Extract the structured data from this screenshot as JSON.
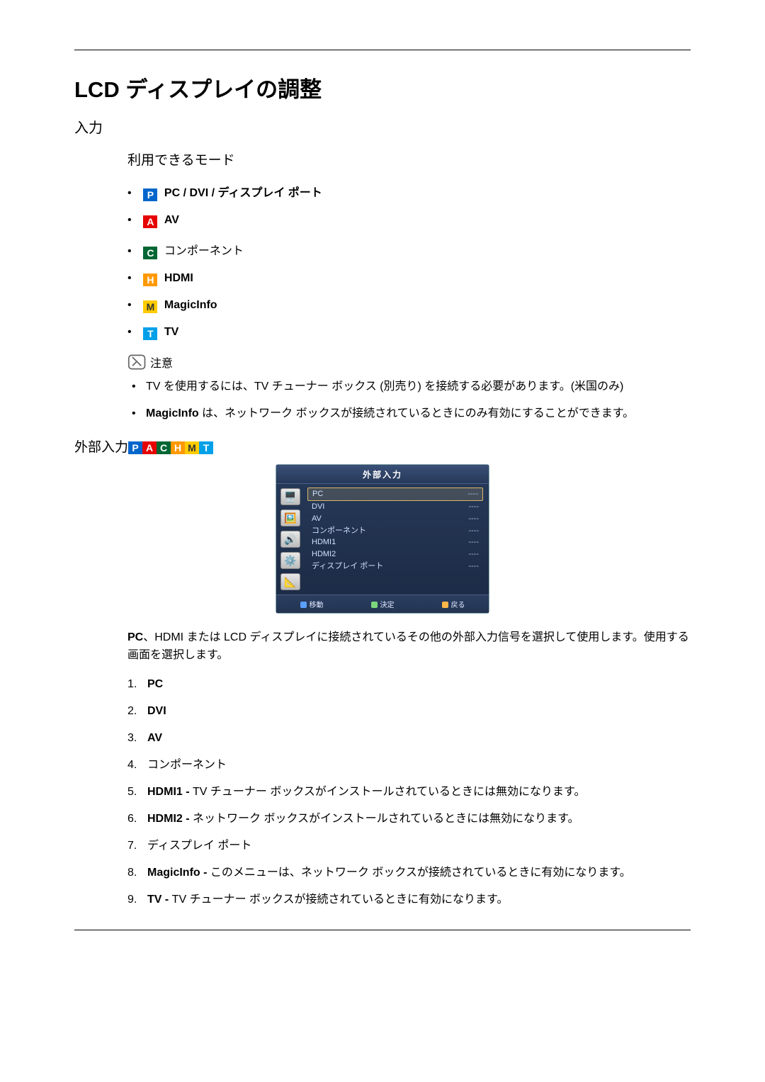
{
  "title": "LCD ディスプレイの調整",
  "section_input": "入力",
  "modes_heading": "利用できるモード",
  "mode_icons": {
    "P": "P",
    "A": "A",
    "C": "C",
    "H": "H",
    "M": "M",
    "T": "T"
  },
  "modes": [
    {
      "icon": "P",
      "label": "PC / DVI / ディスプレイ ポート",
      "bold": true
    },
    {
      "icon": "A",
      "label": "AV",
      "bold": true
    },
    {
      "icon": "C",
      "label": "コンポーネント",
      "bold": false
    },
    {
      "icon": "H",
      "label": "HDMI",
      "bold": true
    },
    {
      "icon": "M",
      "label": "MagicInfo",
      "bold": true
    },
    {
      "icon": "T",
      "label": "TV",
      "bold": true
    }
  ],
  "note_label": "注意",
  "notes": [
    "TV を使用するには、TV チューナー ボックス (別売り) を接続する必要があります。(米国のみ)",
    "MagicInfo は、ネットワーク ボックスが接続されているときにのみ有効にすることができます。"
  ],
  "notes_bold_lead": [
    "",
    "MagicInfo"
  ],
  "ext_heading": "外部入力",
  "osd": {
    "title": "外部入力",
    "rows": [
      {
        "label": "PC",
        "val": "----",
        "sel": true
      },
      {
        "label": "DVI",
        "val": "----",
        "sel": false
      },
      {
        "label": "AV",
        "val": "----",
        "sel": false
      },
      {
        "label": "コンポーネント",
        "val": "----",
        "sel": false
      },
      {
        "label": "HDMI1",
        "val": "----",
        "sel": false
      },
      {
        "label": "HDMI2",
        "val": "----",
        "sel": false
      },
      {
        "label": "ディスプレイ ポート",
        "val": "----",
        "sel": false
      }
    ],
    "foot": {
      "move": "移動",
      "enter": "決定",
      "return": "戻る"
    }
  },
  "ext_desc_lead_bold": "PC",
  "ext_desc_rest": "、HDMI または LCD ディスプレイに接続されているその他の外部入力信号を選択して使用します。使用する画面を選択します。",
  "inputs": [
    {
      "bold": "PC",
      "rest": ""
    },
    {
      "bold": "DVI",
      "rest": ""
    },
    {
      "bold": "AV",
      "rest": ""
    },
    {
      "bold": "",
      "rest": "コンポーネント"
    },
    {
      "bold": "HDMI1 - ",
      "rest": "TV チューナー ボックスがインストールされているときには無効になります。"
    },
    {
      "bold": "HDMI2 - ",
      "rest": "ネットワーク ボックスがインストールされているときには無効になります。"
    },
    {
      "bold": "",
      "rest": "ディスプレイ ポート"
    },
    {
      "bold": "MagicInfo - ",
      "rest": "このメニューは、ネットワーク ボックスが接続されているときに有効になります。"
    },
    {
      "bold": "TV - ",
      "rest": "TV チューナー ボックスが接続されているときに有効になります。"
    }
  ]
}
